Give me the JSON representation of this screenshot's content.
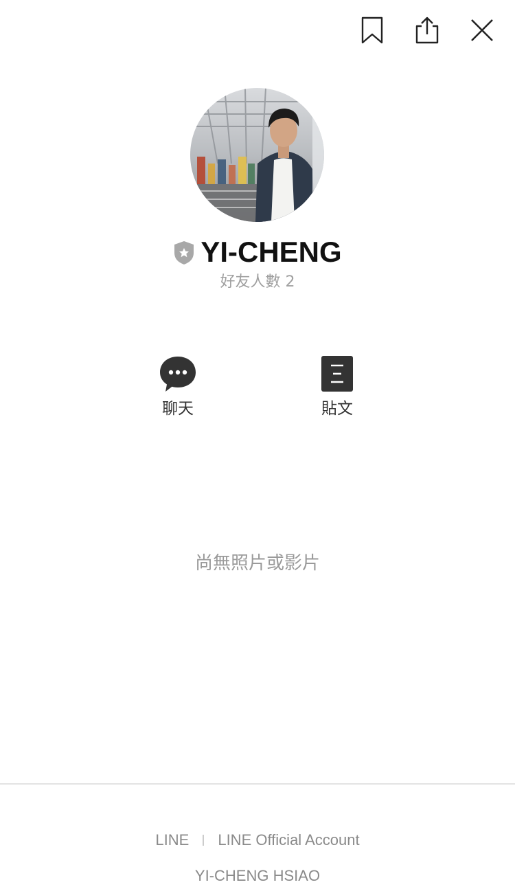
{
  "topbar": {
    "icons": [
      "bookmark-icon",
      "share-icon",
      "close-icon"
    ]
  },
  "profile": {
    "name": "YI-CHENG",
    "friends_count_label": "好友人數 2",
    "badge_icon": "shield-star-icon"
  },
  "actions": [
    {
      "label": "聊天",
      "icon": "chat-bubble-icon"
    },
    {
      "label": "貼文",
      "icon": "post-document-icon"
    }
  ],
  "media": {
    "empty_message": "尚無照片或影片"
  },
  "footer": {
    "link_line": "LINE",
    "link_official": "LINE Official Account",
    "owner": "YI-CHENG HSIAO"
  },
  "colors": {
    "text_primary": "#111111",
    "text_muted": "#9a9a9a",
    "icon_dark": "#333333",
    "badge_gray": "#a8a8a8",
    "divider": "#e3e3e3"
  }
}
